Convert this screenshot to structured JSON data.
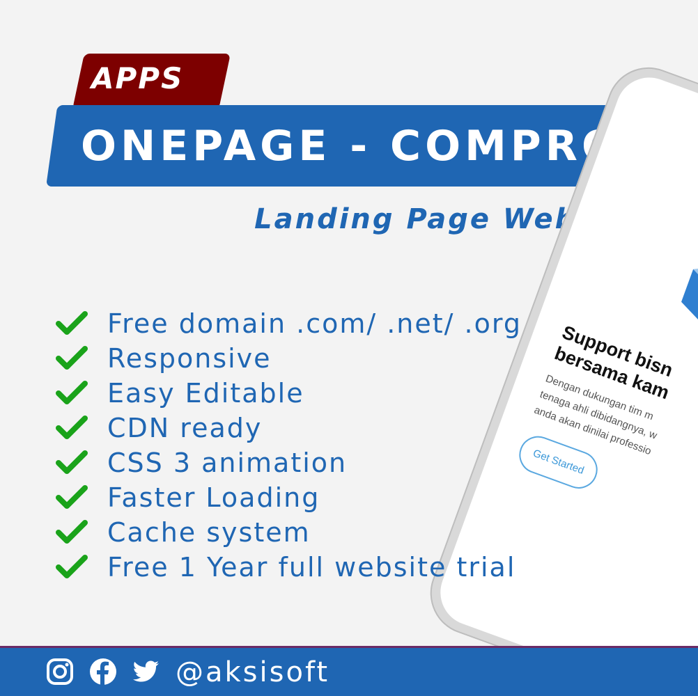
{
  "badge": {
    "label": "APPS"
  },
  "banner": {
    "title": "ONEPAGE - COMPRO"
  },
  "subtitle": "Landing Page Website",
  "features": [
    "Free domain .com/ .net/ .org",
    "Responsive",
    "Easy Editable",
    "CDN ready",
    "CSS 3 animation",
    "Faster Loading",
    "Cache system",
    "Free 1 Year full website trial"
  ],
  "phone": {
    "heading_lines": [
      "Support bisn",
      "bersama kam"
    ],
    "paragraph_lines": [
      "Dengan dukungan tim m",
      "tenaga ahli dibidangnya, w",
      "anda akan dinilai professio"
    ],
    "button_label": "Get Started"
  },
  "footer": {
    "icons": [
      "instagram-icon",
      "facebook-icon",
      "twitter-icon"
    ],
    "handle": "@aksisoft"
  },
  "colors": {
    "background": "#f3f3f3",
    "brand_blue": "#1f66b3",
    "badge_red": "#7d0000",
    "check_green": "#1aa31a",
    "footer_border": "#6b2b66"
  }
}
